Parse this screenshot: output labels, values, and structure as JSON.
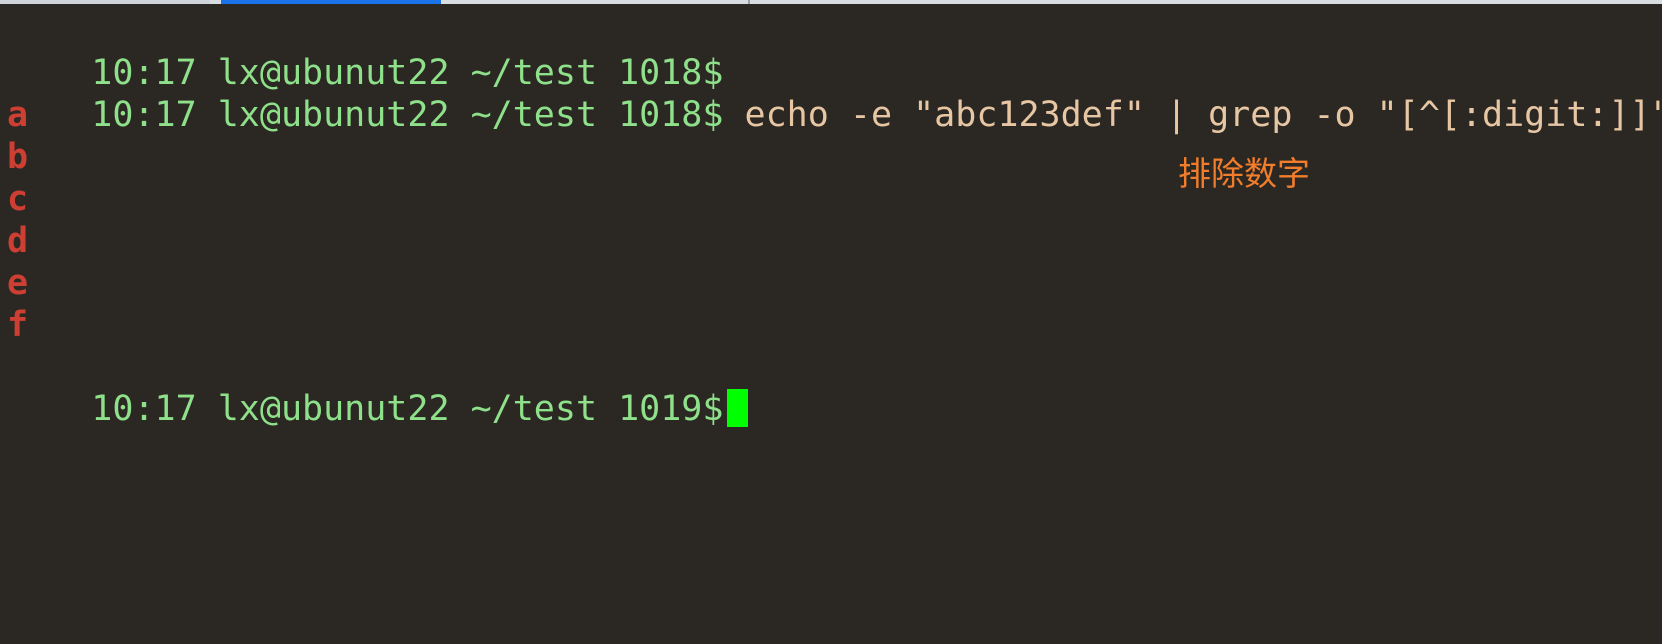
{
  "colors": {
    "background": "#2b2823",
    "prompt": "#8fe08a",
    "command": "#e7c6a3",
    "output": "#cd3f32",
    "cursor": "#00ff00",
    "annotation": "#f27d2a"
  },
  "terminal": {
    "lines": [
      {
        "prompt": "10:17 lx@ubunut22 ~/test 1018$",
        "command": ""
      },
      {
        "prompt": "10:17 lx@ubunut22 ~/test 1018$",
        "command": " echo -e \"abc123def\" | grep -o \"[^[:digit:]]\""
      },
      {
        "output": "a"
      },
      {
        "output": "b"
      },
      {
        "output": "c"
      },
      {
        "output": "d"
      },
      {
        "output": "e"
      },
      {
        "output": "f"
      },
      {
        "prompt": "10:17 lx@ubunut22 ~/test 1019$",
        "command": ""
      }
    ]
  },
  "annotation": {
    "text": "排除数字"
  }
}
